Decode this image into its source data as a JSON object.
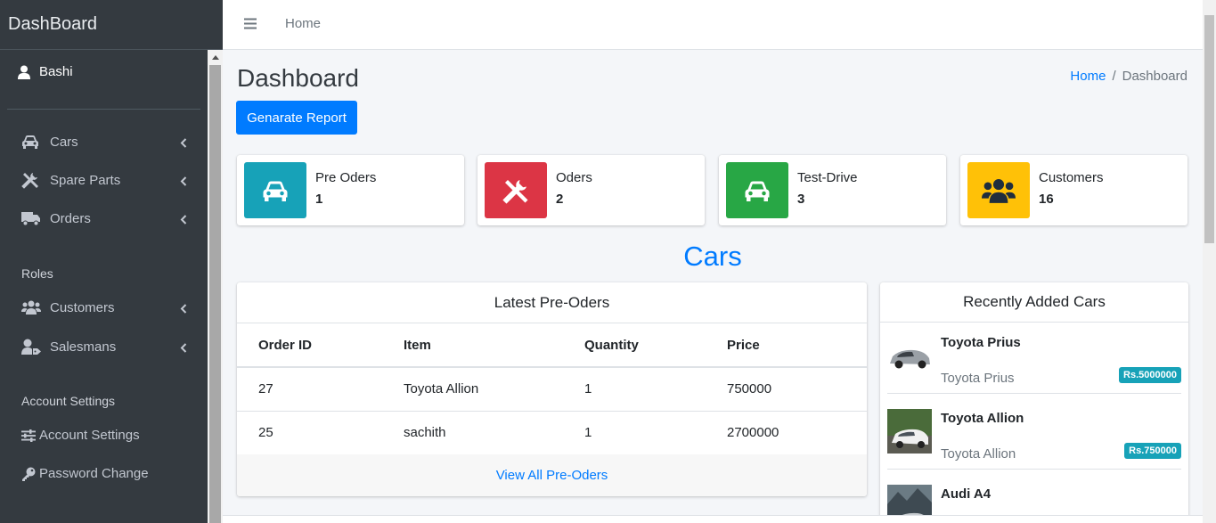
{
  "brand": "DashBoard",
  "user": {
    "name": "Bashi"
  },
  "sidebar": {
    "items": [
      {
        "label": "Cars",
        "icon": "car-icon"
      },
      {
        "label": "Spare Parts",
        "icon": "tools-icon"
      },
      {
        "label": "Orders",
        "icon": "truck-icon"
      }
    ],
    "roles_header": "Roles",
    "role_items": [
      {
        "label": "Customers",
        "icon": "users-icon"
      },
      {
        "label": "Salesmans",
        "icon": "user-tag-icon"
      }
    ],
    "account_header": "Account Settings",
    "account_items": [
      {
        "label": "Account Settings",
        "icon": "sliders-icon"
      },
      {
        "label": "Password Change",
        "icon": "key-icon"
      }
    ]
  },
  "topbar": {
    "home": "Home"
  },
  "page": {
    "title": "Dashboard",
    "breadcrumb": {
      "home": "Home",
      "sep": "/",
      "current": "Dashboard"
    },
    "report_button": "Genarate Report"
  },
  "info_boxes": [
    {
      "label": "Pre Oders",
      "value": "1",
      "icon": "car-icon",
      "color": "#17a2b8"
    },
    {
      "label": "Oders",
      "value": "2",
      "icon": "tools-icon",
      "color": "#dc3545"
    },
    {
      "label": "Test-Drive",
      "value": "3",
      "icon": "car-icon",
      "color": "#28a745"
    },
    {
      "label": "Customers",
      "value": "16",
      "icon": "users-icon",
      "color": "#ffc107"
    }
  ],
  "section_title": "Cars",
  "preorders": {
    "title": "Latest Pre-Oders",
    "columns": [
      "Order ID",
      "Item",
      "Quantity",
      "Price"
    ],
    "rows": [
      [
        "27",
        "Toyota Allion",
        "1",
        "750000"
      ],
      [
        "25",
        "sachith",
        "1",
        "2700000"
      ]
    ],
    "footer_link": "View All Pre-Oders"
  },
  "recent_cars": {
    "title": "Recently Added Cars",
    "items": [
      {
        "name": "Toyota Prius",
        "desc": "Toyota Prius",
        "price": "Rs.5000000"
      },
      {
        "name": "Toyota Allion",
        "desc": "Toyota Allion",
        "price": "Rs.750000"
      },
      {
        "name": "Audi A4",
        "desc": "",
        "price": ""
      }
    ]
  },
  "colors": {
    "primary": "#007bff",
    "sidebar_bg": "#343a40",
    "info": "#17a2b8",
    "danger": "#dc3545",
    "success": "#28a745",
    "warning": "#ffc107"
  }
}
